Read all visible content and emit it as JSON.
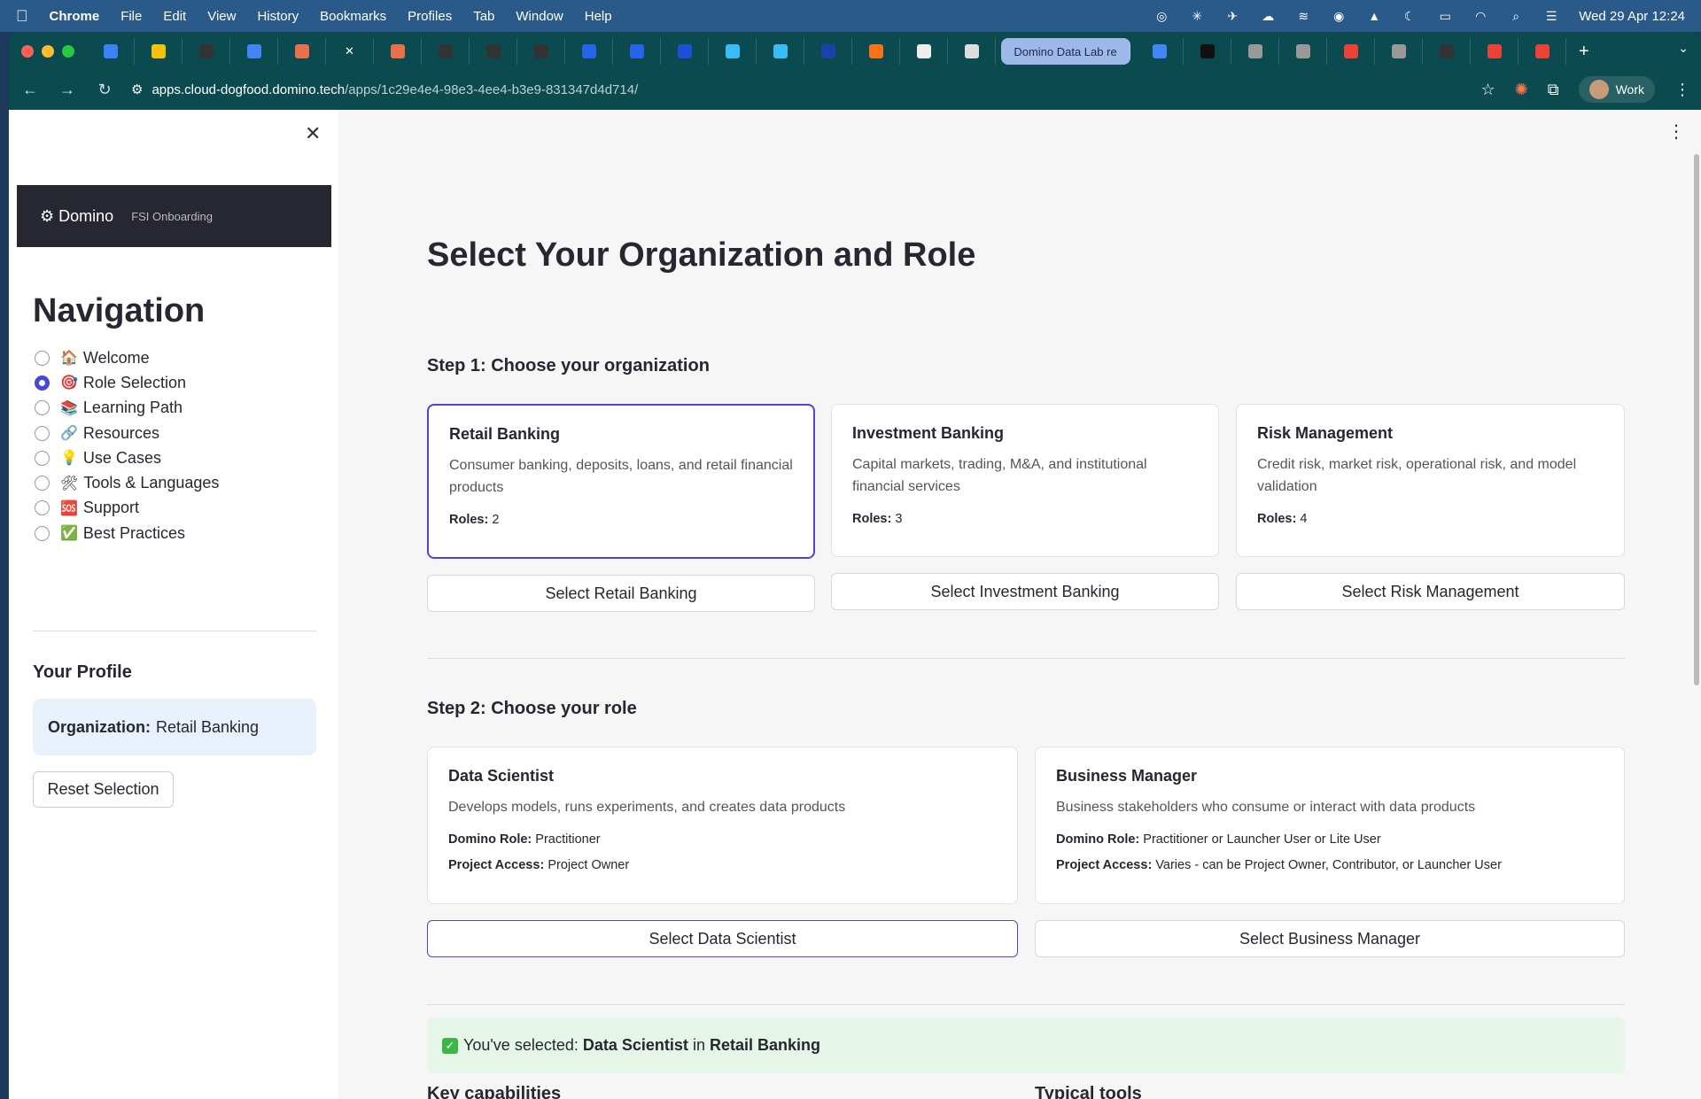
{
  "menubar": {
    "app": "Chrome",
    "items": [
      "File",
      "Edit",
      "View",
      "History",
      "Bookmarks",
      "Profiles",
      "Tab",
      "Window",
      "Help"
    ],
    "clock": "Wed 29 Apr  12:24"
  },
  "browser": {
    "active_tab_title": "Domino Data Lab re",
    "url_host": "apps.cloud-dogfood.domino.tech",
    "url_path": "/apps/1c29e4e4-98e3-4ee4-b3e9-831347d4d714/",
    "profile_label": "Work"
  },
  "sidebar": {
    "brand_name": "Domino",
    "brand_sub": "FSI Onboarding",
    "nav_title": "Navigation",
    "items": [
      {
        "emoji": "🏠",
        "label": "Welcome",
        "checked": false
      },
      {
        "emoji": "🎯",
        "label": "Role Selection",
        "checked": true
      },
      {
        "emoji": "📚",
        "label": "Learning Path",
        "checked": false
      },
      {
        "emoji": "🔗",
        "label": "Resources",
        "checked": false
      },
      {
        "emoji": "💡",
        "label": "Use Cases",
        "checked": false
      },
      {
        "emoji": "🛠",
        "label": "Tools & Languages",
        "checked": false
      },
      {
        "emoji": "🆘",
        "label": "Support",
        "checked": false
      },
      {
        "emoji": "✅",
        "label": "Best Practices",
        "checked": false
      }
    ],
    "profile_title": "Your Profile",
    "profile_org_label": "Organization:",
    "profile_org_value": "Retail Banking",
    "reset_label": "Reset Selection"
  },
  "main": {
    "title": "Select Your Organization and Role",
    "step1": "Step 1: Choose your organization",
    "orgs": [
      {
        "title": "Retail Banking",
        "desc": "Consumer banking, deposits, loans, and retail financial products",
        "roles_label": "Roles:",
        "roles": "2",
        "button": "Select Retail Banking"
      },
      {
        "title": "Investment Banking",
        "desc": "Capital markets, trading, M&A, and institutional financial services",
        "roles_label": "Roles:",
        "roles": "3",
        "button": "Select Investment Banking"
      },
      {
        "title": "Risk Management",
        "desc": "Credit risk, market risk, operational risk, and model validation",
        "roles_label": "Roles:",
        "roles": "4",
        "button": "Select Risk Management"
      }
    ],
    "step2": "Step 2: Choose your role",
    "roles": [
      {
        "title": "Data Scientist",
        "desc": "Develops models, runs experiments, and creates data products",
        "role_label": "Domino Role:",
        "role_value": "Practitioner",
        "access_label": "Project Access:",
        "access_value": "Project Owner",
        "button": "Select Data Scientist"
      },
      {
        "title": "Business Manager",
        "desc": "Business stakeholders who consume or interact with data products",
        "role_label": "Domino Role:",
        "role_value": "Practitioner or Launcher User or Lite User",
        "access_label": "Project Access:",
        "access_value": "Varies - can be Project Owner, Contributor, or Launcher User",
        "button": "Select Business Manager"
      }
    ],
    "success_prefix": "You've selected:",
    "success_role": "Data Scientist",
    "success_in": "in",
    "success_org": "Retail Banking",
    "key_capabilities": "Key capabilities",
    "typical_tools": "Typical tools"
  }
}
